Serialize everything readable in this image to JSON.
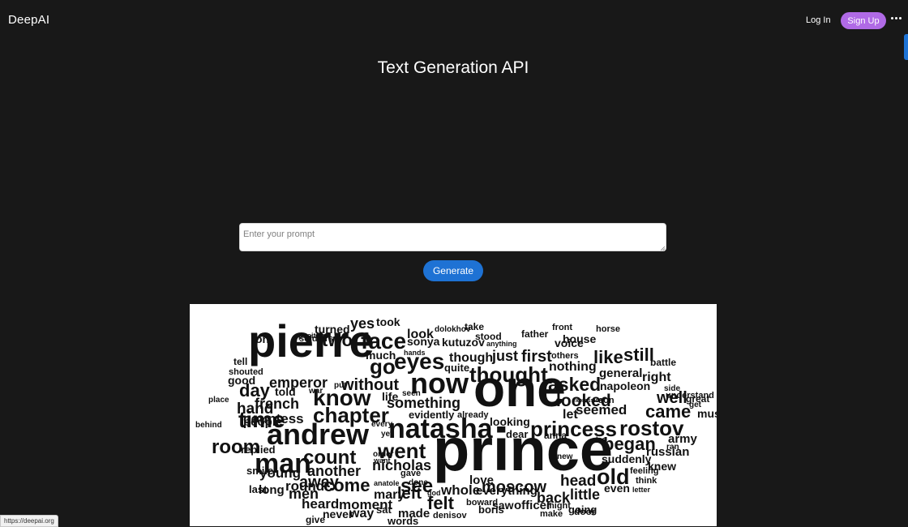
{
  "header": {
    "brand": "DeepAI",
    "login_label": "Log In",
    "signup_label": "Sign Up",
    "more_icon": "more-horizontal-icon"
  },
  "main": {
    "title": "Text Generation API",
    "prompt_placeholder": "Enter your prompt",
    "prompt_value": "",
    "generate_label": "Generate"
  },
  "word_cloud": {
    "words": [
      "prince",
      "one",
      "pierre",
      "natasha",
      "andrew",
      "now",
      "princess",
      "rostov",
      "man",
      "room",
      "time",
      "chapter",
      "went",
      "know",
      "thought",
      "eyes",
      "face",
      "french",
      "see",
      "come",
      "count",
      "asked",
      "looked",
      "came",
      "moscow",
      "began",
      "old",
      "still",
      "like",
      "go",
      "two",
      "without",
      "something",
      "nicholas",
      "emperor",
      "away",
      "another",
      "men",
      "young",
      "head",
      "little",
      "back",
      "first",
      "just",
      "though",
      "well",
      "much",
      "yes",
      "turned",
      "took",
      "look",
      "sonya",
      "kutuzov",
      "stood",
      "father",
      "voice",
      "house",
      "nothing",
      "general",
      "right",
      "napoleon",
      "seemed",
      "must",
      "army",
      "russian",
      "knew",
      "suddenly",
      "even",
      "feeling",
      "think",
      "letter",
      "whole",
      "everything",
      "officer",
      "saw",
      "boris",
      "love",
      "felt",
      "left",
      "mary",
      "made",
      "way",
      "never",
      "heard",
      "round",
      "long",
      "last",
      "smile",
      "replied",
      "countess",
      "people",
      "behind",
      "hand",
      "place",
      "day",
      "good",
      "shouted",
      "tell",
      "oh",
      "soldiers",
      "position",
      "told",
      "war",
      "put",
      "life",
      "seen",
      "evidently",
      "already",
      "every",
      "yet",
      "looking",
      "dear",
      "anna",
      "also",
      "ran",
      "new",
      "order",
      "want",
      "gave",
      "anatole",
      "done",
      "god",
      "moment",
      "sat",
      "words",
      "give",
      "denisov",
      "boward",
      "might",
      "make",
      "going",
      "door",
      "battle",
      "side",
      "understand",
      "great",
      "get",
      "son",
      "expression",
      "others",
      "horse",
      "front",
      "take",
      "dolokhov",
      "anything",
      "hands",
      "quite",
      "let"
    ]
  },
  "status_bar": {
    "url": "https://deepai.org"
  }
}
